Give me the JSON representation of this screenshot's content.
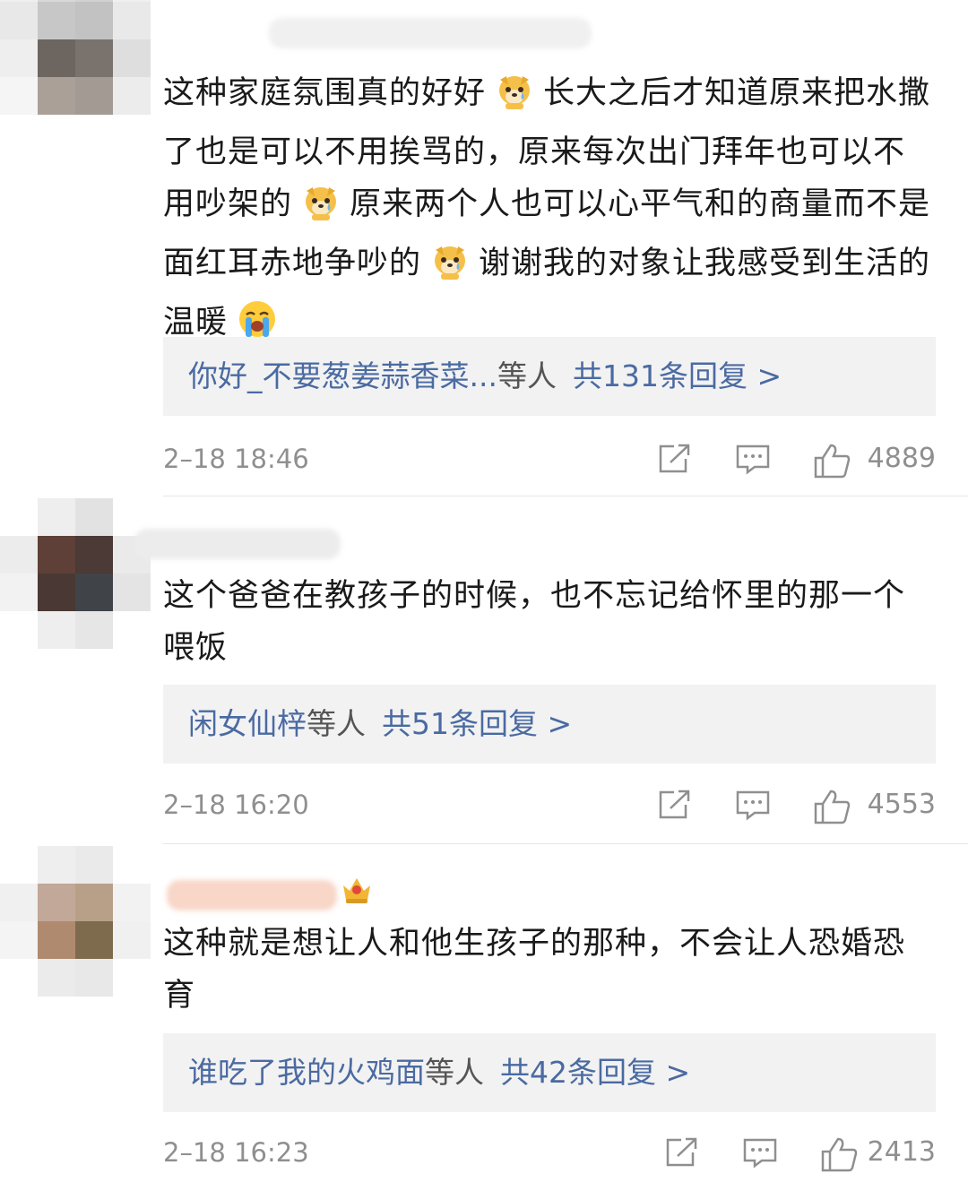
{
  "comments": [
    {
      "content_parts": [
        "这种家庭氛围真的好好",
        "长大之后才知道原来把水撒了也是可以不用挨骂的，原来每次出门拜年也可以不用吵架的",
        "原来两个人也可以心平气和的商量而不是面红耳赤地争吵的",
        "谢谢我的对象让我感受到生活的温暖"
      ],
      "emojis": [
        "dog-sad-emoji",
        "dog-sad-emoji",
        "dog-sad-emoji",
        "loudly-crying-emoji"
      ],
      "reply_names": "你好_不要葱姜蒜香菜...",
      "reply_suffix": "等人",
      "reply_count": "共131条回复 >",
      "time": "2–18 18:46",
      "likes": "4889"
    },
    {
      "content": "这个爸爸在教孩子的时候，也不忘记给怀里的那一个喂饭",
      "reply_names": "闲女仙梓",
      "reply_suffix": "等人",
      "reply_count": "共51条回复 >",
      "time": "2–18 16:20",
      "likes": "4553"
    },
    {
      "content": "这种就是想让人和他生孩子的那种，不会让人恐婚恐育",
      "reply_names": "谁吃了我的火鸡面",
      "reply_suffix": "等人",
      "reply_count": "共42条回复 >",
      "time": "2–18 16:23",
      "likes": "2413"
    }
  ],
  "icons": [
    "share-icon",
    "comment-icon",
    "like-icon",
    "crown-badge-icon"
  ],
  "colors": {
    "link": "#4a6aa2",
    "meta": "#8f8f8f",
    "reply_bg": "#f2f2f2"
  }
}
